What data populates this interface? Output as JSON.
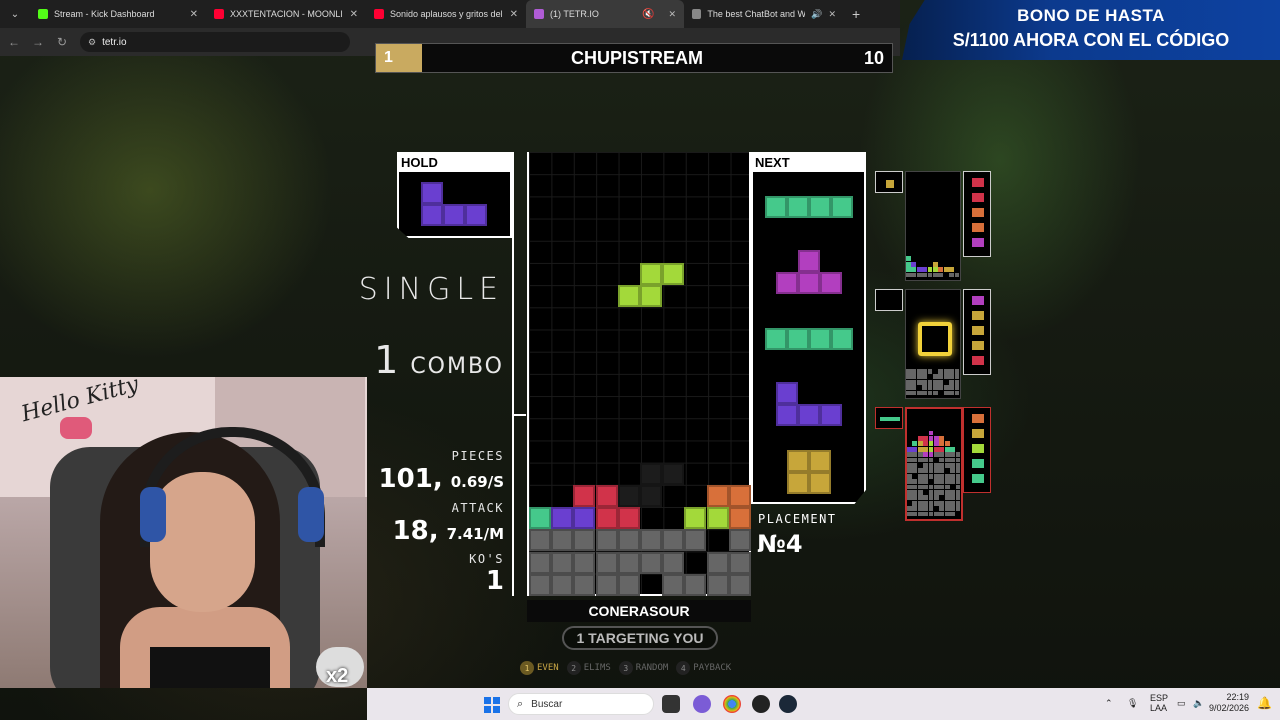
{
  "browser": {
    "tabs": [
      {
        "title": "Stream - Kick Dashboard",
        "fav_color": "#53fc18"
      },
      {
        "title": "XXXTENTACION - MOONLIGHT",
        "fav_color": "#ff0033"
      },
      {
        "title": "Sonido aplausos y gritos del pu",
        "fav_color": "#ff0033"
      },
      {
        "title": "(1) TETR.IO",
        "fav_color": "#b05cd6",
        "active": true
      },
      {
        "title": "The best ChatBot and Widg",
        "fav_color": "#888888"
      }
    ],
    "url": "tetr.io"
  },
  "banner": {
    "line1": "BONO DE HASTA",
    "line2": "S/1100 AHORA CON EL CÓDIGO"
  },
  "match": {
    "left_score": "1",
    "title": "CHUPISTREAM",
    "right_score": "10"
  },
  "board": {
    "hold_label": "HOLD",
    "next_label": "NEXT",
    "action": "SINGLE",
    "combo_count": "1",
    "combo_label": "COMBO",
    "pieces_label": "PIECES",
    "pieces_value": "101,",
    "pieces_rate": "0.69/S",
    "attack_label": "ATTACK",
    "attack_value": "18,",
    "attack_rate": "7.41/M",
    "kos_label": "KO'S",
    "kos_value": "1",
    "placement_label": "PLACEMENT",
    "placement_value": "№4",
    "player_name": "CONERASOUR",
    "targeting": "1 TARGETING YOU",
    "modes": [
      {
        "num": "1",
        "label": "EVEN",
        "active": true
      },
      {
        "num": "2",
        "label": "ELIMS",
        "active": false
      },
      {
        "num": "3",
        "label": "RANDOM",
        "active": false
      },
      {
        "num": "4",
        "label": "PAYBACK",
        "active": false
      }
    ]
  },
  "colors": {
    "purple": "#6a3fd0",
    "red": "#d1334a",
    "green": "#45c98b",
    "lime": "#a3d93a",
    "orange": "#d8703a",
    "yellow": "#c7a63a",
    "magenta": "#b23fbf",
    "garbage": "#666666",
    "gold": "#c9aa60"
  },
  "webcam": {
    "overlay": "x2",
    "wall_text": "Hello Kitty"
  },
  "taskbar": {
    "search_placeholder": "Buscar",
    "lang": "ESP",
    "lang2": "LAA",
    "time": "22:19",
    "date": "9/02/2026"
  }
}
